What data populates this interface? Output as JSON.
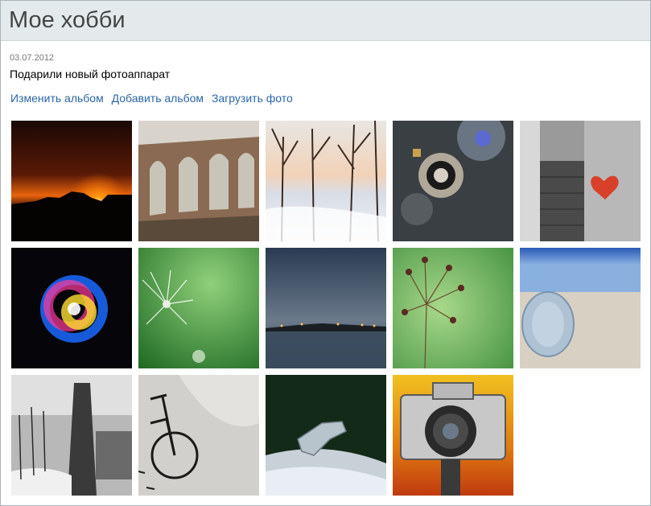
{
  "header": {
    "title": "Мое хобби"
  },
  "album": {
    "date": "03.07.2012",
    "description": "Подарили новый фотоаппарат"
  },
  "actions": {
    "edit": "Изменить альбом",
    "add": "Добавить альбом",
    "upload": "Загрузить фото"
  },
  "photos": [
    "sunset-silhouette",
    "ruined-arches",
    "snowy-forest",
    "camera-lens-macro",
    "heart-on-brick-wall",
    "light-painting-swirl",
    "dandelion-seeds",
    "harbor-night-lights",
    "dill-flower-macro",
    "glass-bottle-on-sand",
    "snowy-street-tree",
    "bicycle-in-snow",
    "car-hood-ornament",
    "vintage-camera"
  ],
  "colors": {
    "link": "#2b67a5",
    "header_bg": "#e4eaeb",
    "border": "#a9b3b9"
  }
}
